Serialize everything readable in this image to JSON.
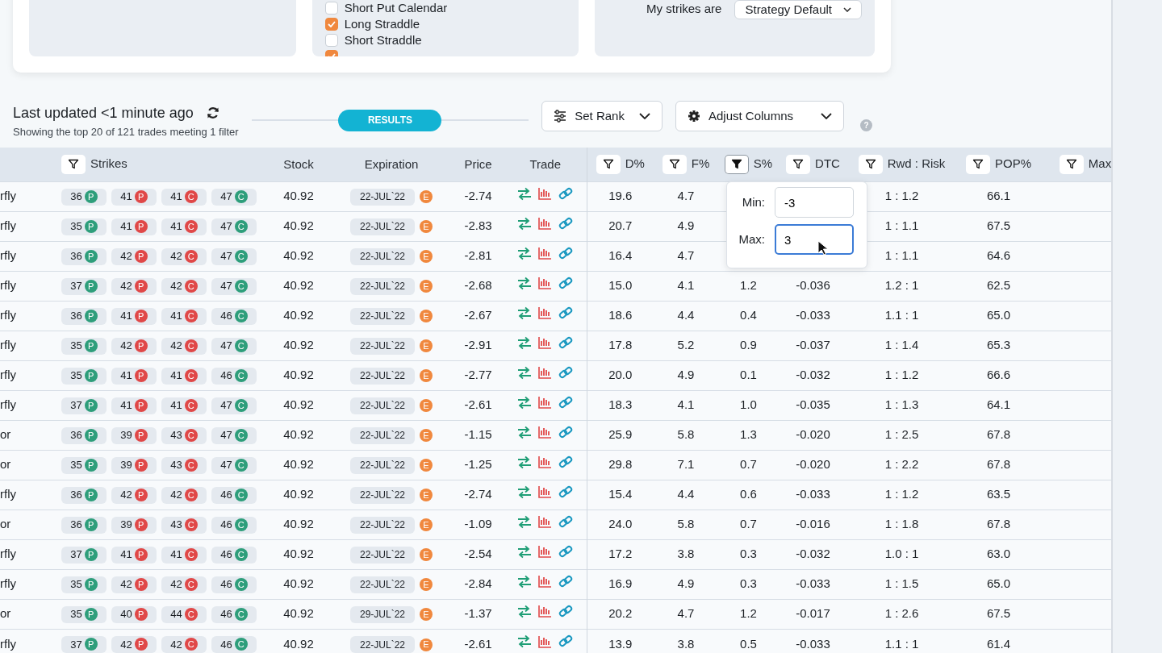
{
  "top_panels": {
    "strategies": [
      {
        "label": "Short Put Calendar",
        "checked": false
      },
      {
        "label": "Long Straddle",
        "checked": true
      },
      {
        "label": "Short Straddle",
        "checked": false
      },
      {
        "checked": true
      }
    ],
    "strikes_label": "My strikes are",
    "strikes_select": "Strategy Default"
  },
  "toolbar": {
    "title": "Last updated <1 minute ago",
    "subtitle": "Showing the top 20 of 121 trades meeting 1 filter",
    "results": "RESULTS",
    "set_rank": "Set Rank",
    "adjust_columns": "Adjust Columns",
    "help": "?"
  },
  "table": {
    "columns": [
      {
        "label": "Strikes",
        "filter_active": false
      },
      {
        "label": "Stock"
      },
      {
        "label": "Expiration"
      },
      {
        "label": "Price"
      },
      {
        "label": "Trade"
      },
      {
        "label": "D%",
        "filter_active": false
      },
      {
        "label": "F%",
        "filter_active": false
      },
      {
        "label": "S%",
        "filter_active": true
      },
      {
        "label": "DTC",
        "filter_active": false
      },
      {
        "label": "Rwd : Risk",
        "filter_active": false
      },
      {
        "label": "POP%",
        "filter_active": false
      },
      {
        "label": "Max",
        "filter_active": false
      }
    ],
    "rows": [
      {
        "name": "rfly",
        "legs": [
          {
            "strike": "36",
            "type": "P",
            "color": "#2e9e7b"
          },
          {
            "strike": "41",
            "type": "P",
            "color": "#e04848"
          },
          {
            "strike": "41",
            "type": "C",
            "color": "#e04848"
          },
          {
            "strike": "47",
            "type": "C",
            "color": "#2e9e7b"
          }
        ],
        "stock": "40.92",
        "expiration": "22-JUL`22",
        "earnings": "E",
        "price": "-2.74",
        "d": "19.6",
        "f": "4.7",
        "rwd_risk": "1 : 1.2",
        "pop": "66.1"
      },
      {
        "name": "rfly",
        "legs": [
          {
            "strike": "35",
            "type": "P",
            "color": "#2e9e7b"
          },
          {
            "strike": "41",
            "type": "P",
            "color": "#e04848"
          },
          {
            "strike": "41",
            "type": "C",
            "color": "#e04848"
          },
          {
            "strike": "47",
            "type": "C",
            "color": "#2e9e7b"
          }
        ],
        "stock": "40.92",
        "expiration": "22-JUL`22",
        "earnings": "E",
        "price": "-2.83",
        "d": "20.7",
        "f": "4.9",
        "rwd_risk": "1 : 1.1",
        "pop": "67.5"
      },
      {
        "name": "rfly",
        "legs": [
          {
            "strike": "36",
            "type": "P",
            "color": "#2e9e7b"
          },
          {
            "strike": "42",
            "type": "P",
            "color": "#e04848"
          },
          {
            "strike": "42",
            "type": "C",
            "color": "#e04848"
          },
          {
            "strike": "47",
            "type": "C",
            "color": "#2e9e7b"
          }
        ],
        "stock": "40.92",
        "expiration": "22-JUL`22",
        "earnings": "E",
        "price": "-2.81",
        "d": "16.4",
        "f": "4.7",
        "rwd_risk": "1 : 1.1",
        "pop": "64.6"
      },
      {
        "name": "rfly",
        "legs": [
          {
            "strike": "37",
            "type": "P",
            "color": "#2e9e7b"
          },
          {
            "strike": "42",
            "type": "P",
            "color": "#e04848"
          },
          {
            "strike": "42",
            "type": "C",
            "color": "#e04848"
          },
          {
            "strike": "47",
            "type": "C",
            "color": "#2e9e7b"
          }
        ],
        "stock": "40.92",
        "expiration": "22-JUL`22",
        "earnings": "E",
        "price": "-2.68",
        "d": "15.0",
        "f": "4.1",
        "s": "1.2",
        "dtc": "-0.036",
        "rwd_risk": "1.2 : 1",
        "pop": "62.5"
      },
      {
        "name": "rfly",
        "legs": [
          {
            "strike": "36",
            "type": "P",
            "color": "#2e9e7b"
          },
          {
            "strike": "41",
            "type": "P",
            "color": "#e04848"
          },
          {
            "strike": "41",
            "type": "C",
            "color": "#e04848"
          },
          {
            "strike": "46",
            "type": "C",
            "color": "#2e9e7b"
          }
        ],
        "stock": "40.92",
        "expiration": "22-JUL`22",
        "earnings": "E",
        "price": "-2.67",
        "d": "18.6",
        "f": "4.4",
        "s": "0.4",
        "dtc": "-0.033",
        "rwd_risk": "1.1 : 1",
        "pop": "65.0"
      },
      {
        "name": "rfly",
        "legs": [
          {
            "strike": "35",
            "type": "P",
            "color": "#2e9e7b"
          },
          {
            "strike": "42",
            "type": "P",
            "color": "#e04848"
          },
          {
            "strike": "42",
            "type": "C",
            "color": "#e04848"
          },
          {
            "strike": "47",
            "type": "C",
            "color": "#2e9e7b"
          }
        ],
        "stock": "40.92",
        "expiration": "22-JUL`22",
        "earnings": "E",
        "price": "-2.91",
        "d": "17.8",
        "f": "5.2",
        "s": "0.9",
        "dtc": "-0.037",
        "rwd_risk": "1 : 1.4",
        "pop": "65.3"
      },
      {
        "name": "rfly",
        "legs": [
          {
            "strike": "35",
            "type": "P",
            "color": "#2e9e7b"
          },
          {
            "strike": "41",
            "type": "P",
            "color": "#e04848"
          },
          {
            "strike": "41",
            "type": "C",
            "color": "#e04848"
          },
          {
            "strike": "46",
            "type": "C",
            "color": "#2e9e7b"
          }
        ],
        "stock": "40.92",
        "expiration": "22-JUL`22",
        "earnings": "E",
        "price": "-2.77",
        "d": "20.0",
        "f": "4.9",
        "s": "0.1",
        "dtc": "-0.032",
        "rwd_risk": "1 : 1.2",
        "pop": "66.6"
      },
      {
        "name": "rfly",
        "legs": [
          {
            "strike": "37",
            "type": "P",
            "color": "#2e9e7b"
          },
          {
            "strike": "41",
            "type": "P",
            "color": "#e04848"
          },
          {
            "strike": "41",
            "type": "C",
            "color": "#e04848"
          },
          {
            "strike": "47",
            "type": "C",
            "color": "#2e9e7b"
          }
        ],
        "stock": "40.92",
        "expiration": "22-JUL`22",
        "earnings": "E",
        "price": "-2.61",
        "d": "18.3",
        "f": "4.1",
        "s": "1.0",
        "dtc": "-0.035",
        "rwd_risk": "1 : 1.3",
        "pop": "64.1"
      },
      {
        "name": "or",
        "legs": [
          {
            "strike": "36",
            "type": "P",
            "color": "#2e9e7b"
          },
          {
            "strike": "39",
            "type": "P",
            "color": "#e04848"
          },
          {
            "strike": "43",
            "type": "C",
            "color": "#e04848"
          },
          {
            "strike": "47",
            "type": "C",
            "color": "#2e9e7b"
          }
        ],
        "stock": "40.92",
        "expiration": "22-JUL`22",
        "earnings": "E",
        "price": "-1.15",
        "d": "25.9",
        "f": "5.8",
        "s": "1.3",
        "dtc": "-0.020",
        "rwd_risk": "1 : 2.5",
        "pop": "67.8"
      },
      {
        "name": "or",
        "legs": [
          {
            "strike": "35",
            "type": "P",
            "color": "#2e9e7b"
          },
          {
            "strike": "39",
            "type": "P",
            "color": "#e04848"
          },
          {
            "strike": "43",
            "type": "C",
            "color": "#e04848"
          },
          {
            "strike": "47",
            "type": "C",
            "color": "#2e9e7b"
          }
        ],
        "stock": "40.92",
        "expiration": "22-JUL`22",
        "earnings": "E",
        "price": "-1.25",
        "d": "29.8",
        "f": "7.1",
        "s": "0.7",
        "dtc": "-0.020",
        "rwd_risk": "1 : 2.2",
        "pop": "67.8"
      },
      {
        "name": "rfly",
        "legs": [
          {
            "strike": "36",
            "type": "P",
            "color": "#2e9e7b"
          },
          {
            "strike": "42",
            "type": "P",
            "color": "#e04848"
          },
          {
            "strike": "42",
            "type": "C",
            "color": "#e04848"
          },
          {
            "strike": "46",
            "type": "C",
            "color": "#2e9e7b"
          }
        ],
        "stock": "40.92",
        "expiration": "22-JUL`22",
        "earnings": "E",
        "price": "-2.74",
        "d": "15.4",
        "f": "4.4",
        "s": "0.6",
        "dtc": "-0.033",
        "rwd_risk": "1 : 1.2",
        "pop": "63.5"
      },
      {
        "name": "or",
        "legs": [
          {
            "strike": "36",
            "type": "P",
            "color": "#2e9e7b"
          },
          {
            "strike": "39",
            "type": "P",
            "color": "#e04848"
          },
          {
            "strike": "43",
            "type": "C",
            "color": "#e04848"
          },
          {
            "strike": "46",
            "type": "C",
            "color": "#2e9e7b"
          }
        ],
        "stock": "40.92",
        "expiration": "22-JUL`22",
        "earnings": "E",
        "price": "-1.09",
        "d": "24.0",
        "f": "5.8",
        "s": "0.7",
        "dtc": "-0.016",
        "rwd_risk": "1 : 1.8",
        "pop": "67.8"
      },
      {
        "name": "rfly",
        "legs": [
          {
            "strike": "37",
            "type": "P",
            "color": "#2e9e7b"
          },
          {
            "strike": "41",
            "type": "P",
            "color": "#e04848"
          },
          {
            "strike": "41",
            "type": "C",
            "color": "#e04848"
          },
          {
            "strike": "46",
            "type": "C",
            "color": "#2e9e7b"
          }
        ],
        "stock": "40.92",
        "expiration": "22-JUL`22",
        "earnings": "E",
        "price": "-2.54",
        "d": "17.2",
        "f": "3.8",
        "s": "0.3",
        "dtc": "-0.032",
        "rwd_risk": "1.0 : 1",
        "pop": "63.0"
      },
      {
        "name": "rfly",
        "legs": [
          {
            "strike": "35",
            "type": "P",
            "color": "#2e9e7b"
          },
          {
            "strike": "42",
            "type": "P",
            "color": "#e04848"
          },
          {
            "strike": "42",
            "type": "C",
            "color": "#e04848"
          },
          {
            "strike": "46",
            "type": "C",
            "color": "#2e9e7b"
          }
        ],
        "stock": "40.92",
        "expiration": "22-JUL`22",
        "earnings": "E",
        "price": "-2.84",
        "d": "16.9",
        "f": "4.9",
        "s": "0.3",
        "dtc": "-0.033",
        "rwd_risk": "1 : 1.5",
        "pop": "65.0"
      },
      {
        "name": "or",
        "legs": [
          {
            "strike": "35",
            "type": "P",
            "color": "#2e9e7b"
          },
          {
            "strike": "40",
            "type": "P",
            "color": "#e04848"
          },
          {
            "strike": "44",
            "type": "C",
            "color": "#e04848"
          },
          {
            "strike": "46",
            "type": "C",
            "color": "#2e9e7b"
          }
        ],
        "stock": "40.92",
        "expiration": "29-JUL`22",
        "earnings": "E",
        "price": "-1.37",
        "d": "20.2",
        "f": "4.7",
        "s": "1.2",
        "dtc": "-0.017",
        "rwd_risk": "1 : 2.6",
        "pop": "67.5"
      },
      {
        "name": "rfly",
        "legs": [
          {
            "strike": "37",
            "type": "P",
            "color": "#2e9e7b"
          },
          {
            "strike": "42",
            "type": "P",
            "color": "#e04848"
          },
          {
            "strike": "42",
            "type": "C",
            "color": "#e04848"
          },
          {
            "strike": "46",
            "type": "C",
            "color": "#2e9e7b"
          }
        ],
        "stock": "40.92",
        "expiration": "22-JUL`22",
        "earnings": "E",
        "price": "-2.61",
        "d": "13.9",
        "f": "3.8",
        "s": "0.5",
        "dtc": "-0.033",
        "rwd_risk": "1.1 : 1",
        "pop": "61.4"
      }
    ]
  },
  "filter_popover": {
    "fields": [
      {
        "label": "Min:",
        "value": "-3",
        "focused": false
      },
      {
        "label": "Max:",
        "value": "3",
        "focused": true
      }
    ]
  }
}
